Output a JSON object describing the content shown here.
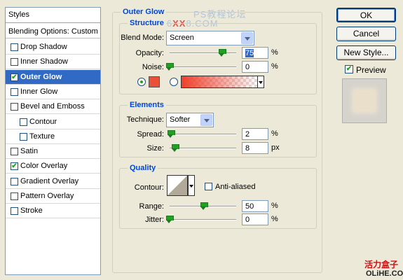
{
  "styles_panel": {
    "header": "Styles",
    "blending_options": "Blending Options: Custom",
    "items": [
      {
        "label": "Drop Shadow",
        "checked": false,
        "selected": false,
        "sub": false
      },
      {
        "label": "Inner Shadow",
        "checked": false,
        "selected": false,
        "sub": false
      },
      {
        "label": "Outer Glow",
        "checked": true,
        "selected": true,
        "sub": false
      },
      {
        "label": "Inner Glow",
        "checked": false,
        "selected": false,
        "sub": false
      },
      {
        "label": "Bevel and Emboss",
        "checked": false,
        "selected": false,
        "sub": false
      },
      {
        "label": "Contour",
        "checked": false,
        "selected": false,
        "sub": true
      },
      {
        "label": "Texture",
        "checked": false,
        "selected": false,
        "sub": true
      },
      {
        "label": "Satin",
        "checked": false,
        "selected": false,
        "sub": false
      },
      {
        "label": "Color Overlay",
        "checked": true,
        "selected": false,
        "sub": false
      },
      {
        "label": "Gradient Overlay",
        "checked": false,
        "selected": false,
        "sub": false
      },
      {
        "label": "Pattern Overlay",
        "checked": false,
        "selected": false,
        "sub": false
      },
      {
        "label": "Stroke",
        "checked": false,
        "selected": false,
        "sub": false
      }
    ]
  },
  "outer_glow": {
    "title": "Outer Glow",
    "structure": {
      "title": "Structure",
      "blend_mode_label": "Blend Mode:",
      "blend_mode_value": "Screen",
      "opacity_label": "Opacity:",
      "opacity_value": "75",
      "opacity_unit": "%",
      "noise_label": "Noise:",
      "noise_value": "0",
      "noise_unit": "%",
      "color_swatch": "#e8503a",
      "gradient_start": "#f0402a"
    },
    "elements": {
      "title": "Elements",
      "technique_label": "Technique:",
      "technique_value": "Softer",
      "spread_label": "Spread:",
      "spread_value": "2",
      "spread_unit": "%",
      "size_label": "Size:",
      "size_value": "8",
      "size_unit": "px"
    },
    "quality": {
      "title": "Quality",
      "contour_label": "Contour:",
      "anti_aliased_label": "Anti-aliased",
      "anti_aliased_checked": false,
      "range_label": "Range:",
      "range_value": "50",
      "range_unit": "%",
      "jitter_label": "Jitter:",
      "jitter_value": "0",
      "jitter_unit": "%"
    }
  },
  "buttons": {
    "ok": "OK",
    "cancel": "Cancel",
    "new_style": "New Style...",
    "preview_label": "Preview",
    "preview_checked": true
  },
  "watermark": {
    "line1": "PS教程论坛",
    "line2_a": "BBS.16",
    "line2_b": "XX",
    "line2_c": "8.COM"
  },
  "site": {
    "cn": "活力盒子",
    "url": "OLiHE.COM"
  }
}
